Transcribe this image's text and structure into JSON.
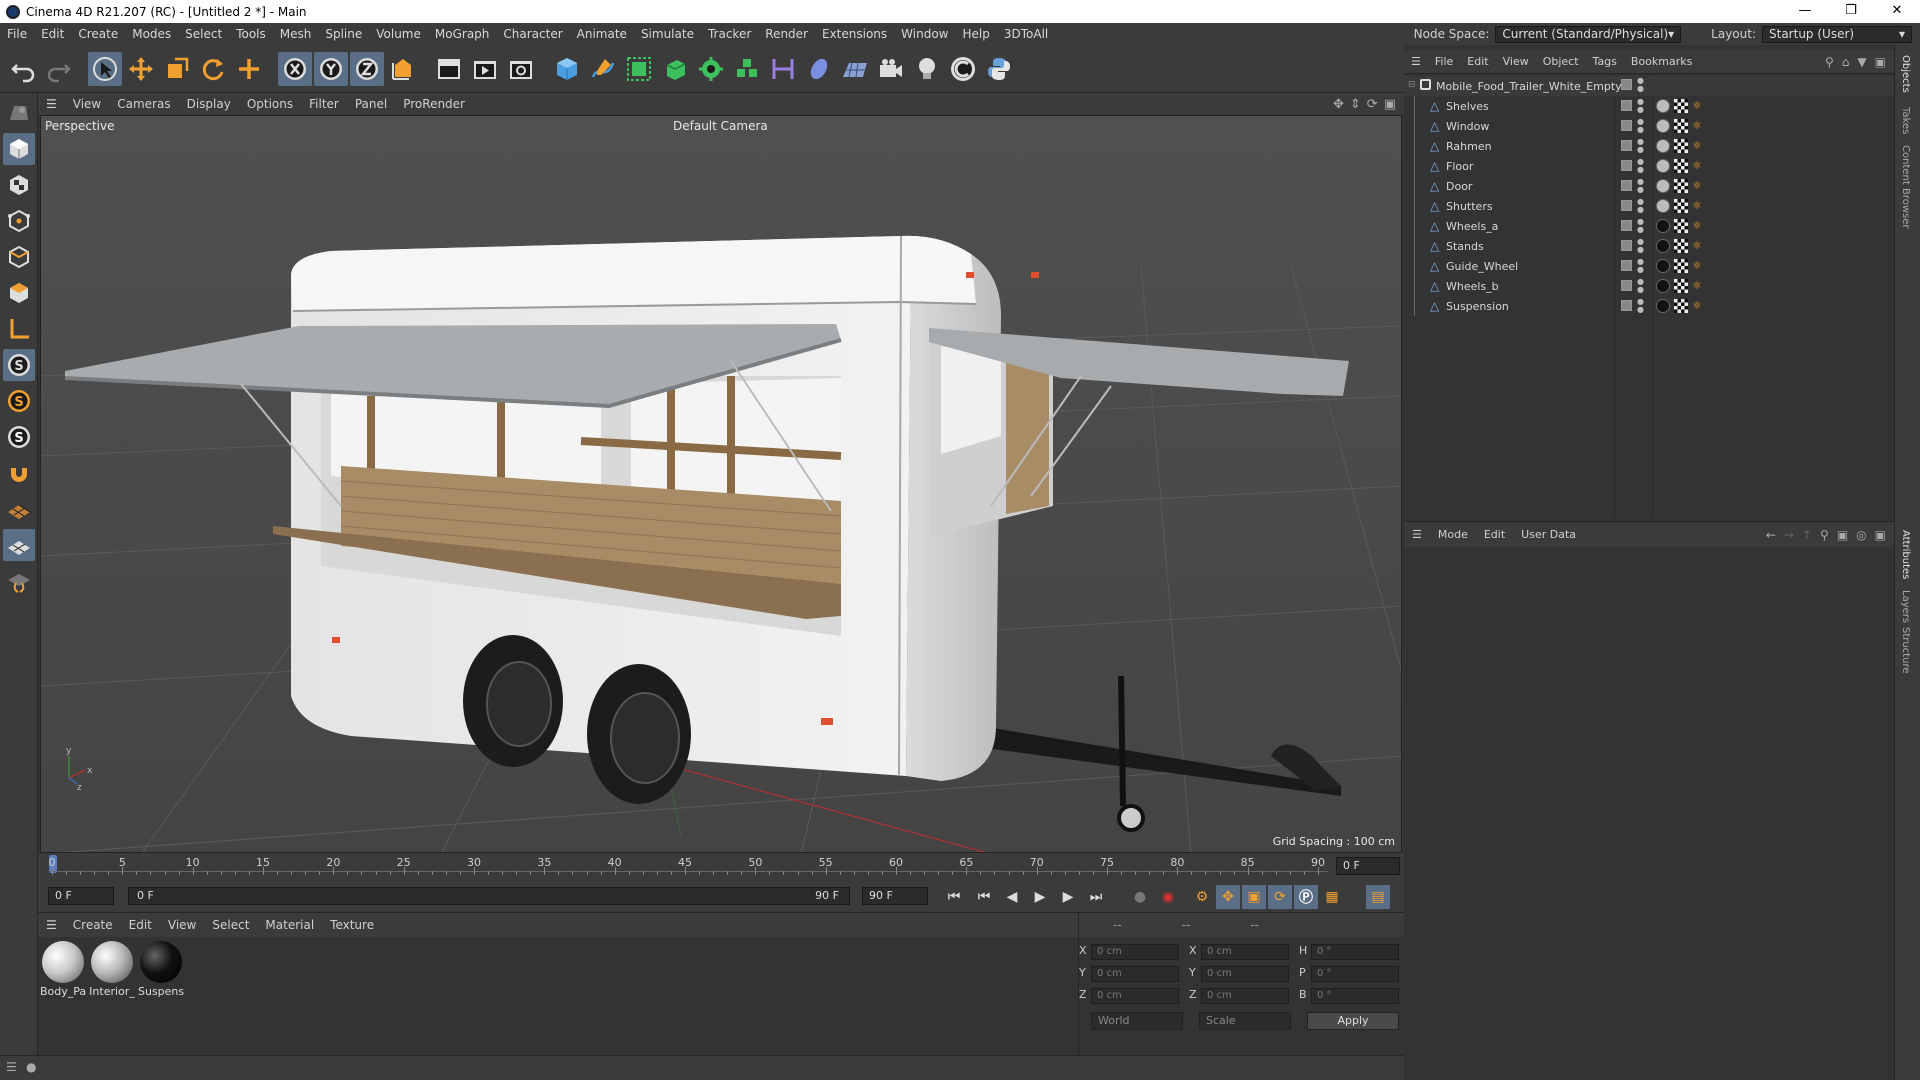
{
  "window": {
    "title": "Cinema 4D R21.207 (RC) - [Untitled 2 *] - Main"
  },
  "menu": [
    "File",
    "Edit",
    "Create",
    "Modes",
    "Select",
    "Tools",
    "Mesh",
    "Spline",
    "Volume",
    "MoGraph",
    "Character",
    "Animate",
    "Simulate",
    "Tracker",
    "Render",
    "Extensions",
    "Window",
    "Help",
    "3DToAll"
  ],
  "node_space": {
    "label": "Node Space:",
    "value": "Current (Standard/Physical)"
  },
  "layout": {
    "label": "Layout:",
    "value": "Startup (User)"
  },
  "viewport": {
    "menu": [
      "View",
      "Cameras",
      "Display",
      "Options",
      "Filter",
      "Panel",
      "ProRender"
    ],
    "view_name": "Perspective",
    "camera": "Default Camera",
    "grid_spacing": "Grid Spacing : 100 cm"
  },
  "timeline": {
    "ticks": [
      "0",
      "5",
      "10",
      "15",
      "20",
      "25",
      "30",
      "35",
      "40",
      "45",
      "50",
      "55",
      "60",
      "65",
      "70",
      "75",
      "80",
      "85",
      "90"
    ],
    "current_frame": "0 F",
    "start_field": "0 F",
    "slider_start": "0 F",
    "slider_end": "90 F",
    "end_field": "90 F"
  },
  "material_manager": {
    "menu": [
      "Create",
      "Edit",
      "View",
      "Select",
      "Material",
      "Texture"
    ],
    "materials": [
      {
        "name": "Body_Pa",
        "color": "#c9c9c9"
      },
      {
        "name": "Interior_",
        "color": "#b8b8b8"
      },
      {
        "name": "Suspens",
        "color": "#111111"
      }
    ]
  },
  "coordinates": {
    "header": [
      "--",
      "--",
      "--"
    ],
    "rows": [
      {
        "a": "X",
        "av": "0 cm",
        "b": "X",
        "bv": "0 cm",
        "c": "H",
        "cv": "0 °"
      },
      {
        "a": "Y",
        "av": "0 cm",
        "b": "Y",
        "bv": "0 cm",
        "c": "P",
        "cv": "0 °"
      },
      {
        "a": "Z",
        "av": "0 cm",
        "b": "Z",
        "bv": "0 cm",
        "c": "B",
        "cv": "0 °"
      }
    ],
    "world": "World",
    "scale": "Scale",
    "apply": "Apply"
  },
  "object_manager": {
    "menu": [
      "File",
      "Edit",
      "View",
      "Object",
      "Tags",
      "Bookmarks"
    ],
    "root": "Mobile_Food_Trailer_White_Empty",
    "objects": [
      {
        "name": "Shelves",
        "mat": "#bdbdbd"
      },
      {
        "name": "Window",
        "mat": "#bdbdbd"
      },
      {
        "name": "Rahmen",
        "mat": "#bdbdbd"
      },
      {
        "name": "Floor",
        "mat": "#bdbdbd"
      },
      {
        "name": "Door",
        "mat": "#bdbdbd"
      },
      {
        "name": "Shutters",
        "mat": "#bdbdbd"
      },
      {
        "name": "Wheels_a",
        "mat": "#111111"
      },
      {
        "name": "Stands",
        "mat": "#111111"
      },
      {
        "name": "Guide_Wheel",
        "mat": "#111111"
      },
      {
        "name": "Wheels_b",
        "mat": "#111111"
      },
      {
        "name": "Suspension",
        "mat": "#111111"
      }
    ]
  },
  "attributes": {
    "menu": [
      "Mode",
      "Edit",
      "User Data"
    ]
  },
  "right_tabs": [
    "Objects",
    "Takes",
    "Content Browser",
    "Attributes",
    "Layers",
    "Structure"
  ],
  "colors": {
    "accent": "#5a6e86",
    "panel": "#3b3b3b",
    "bg": "#333333",
    "viewport": "#4a4a4a",
    "playhead": "#5a7ec0"
  }
}
